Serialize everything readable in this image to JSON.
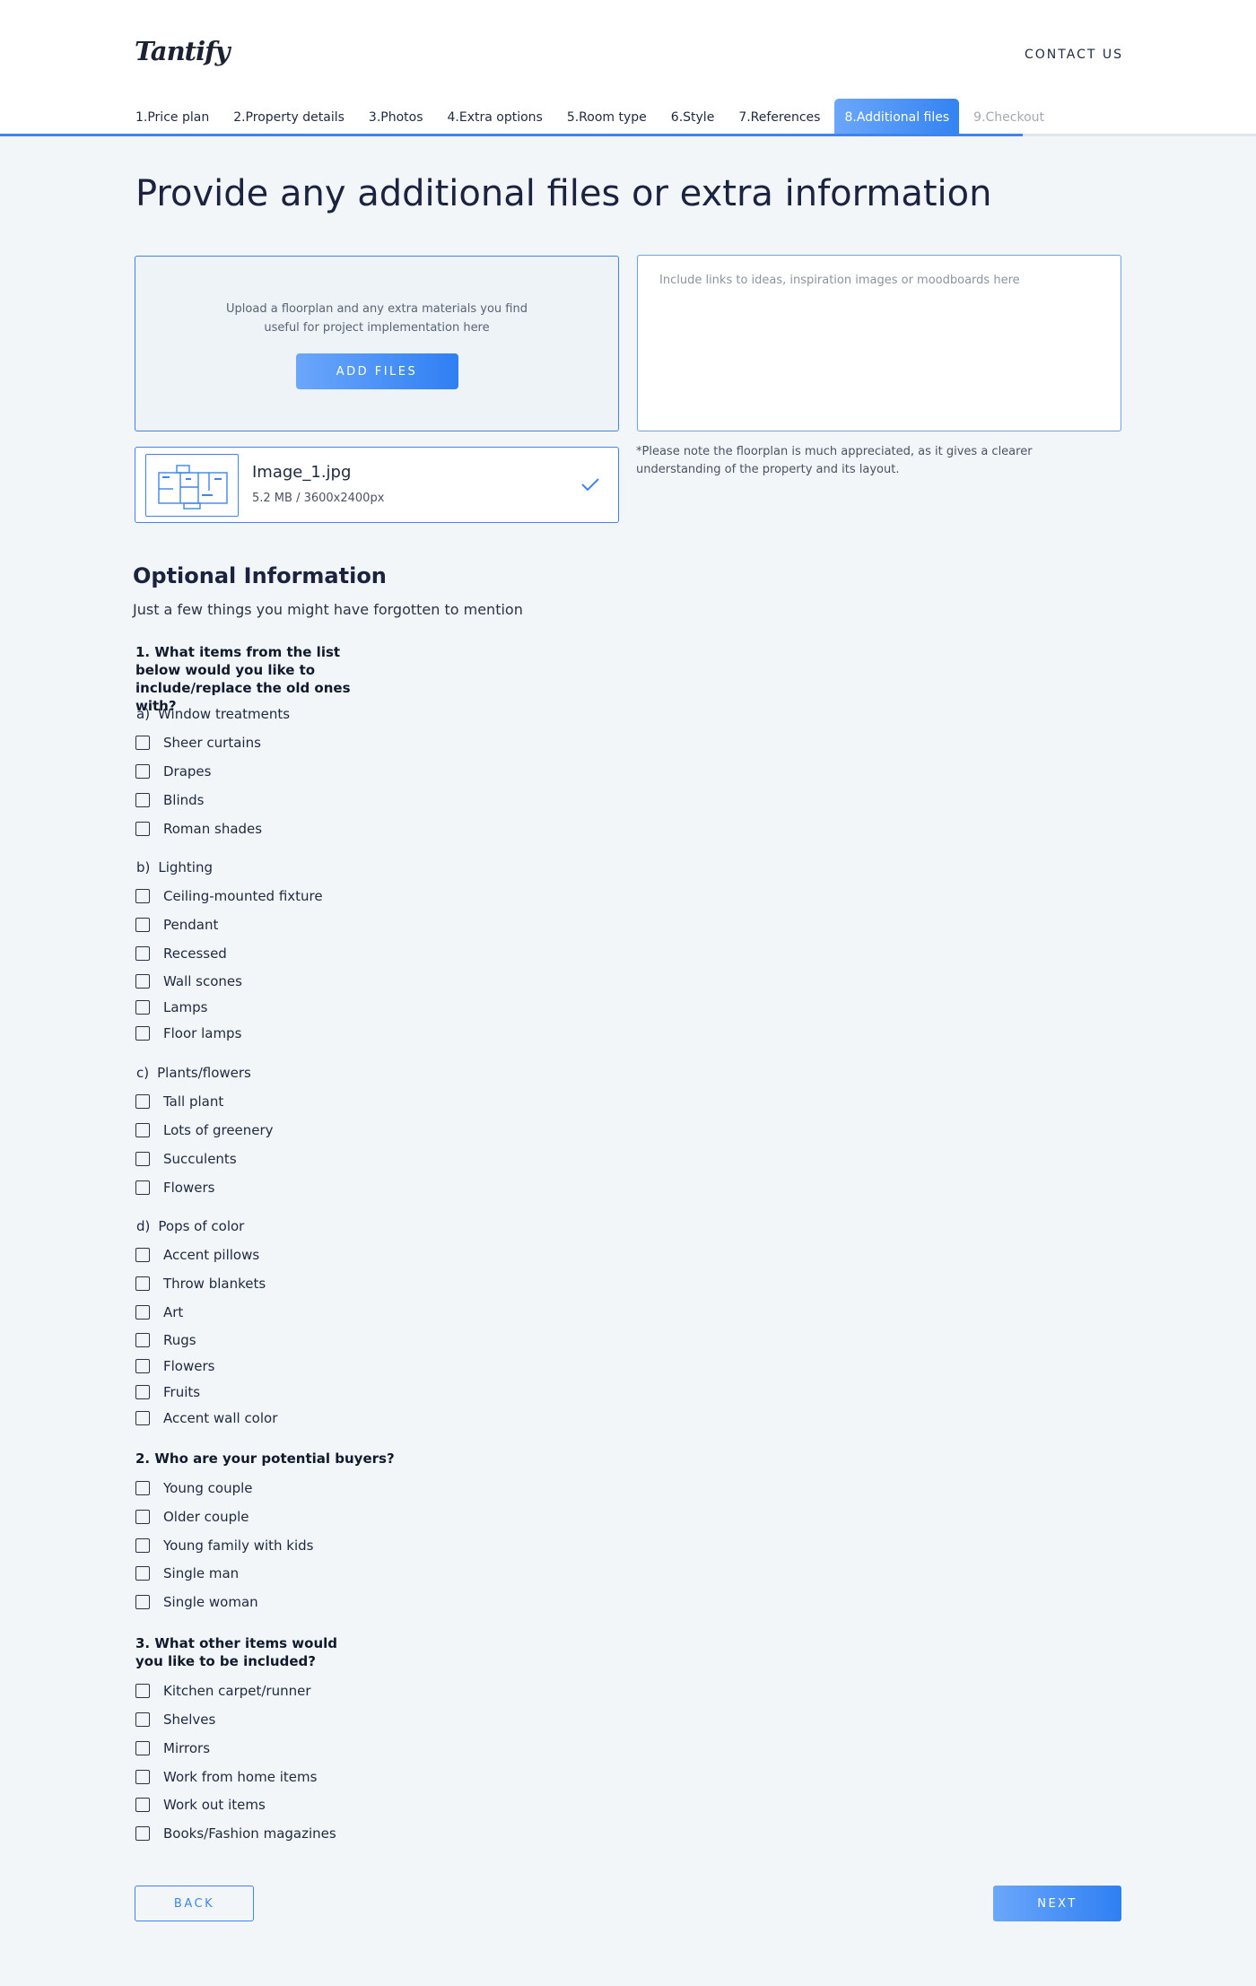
{
  "brand": {
    "logo": "Tantify"
  },
  "header": {
    "contact": "CONTACT US"
  },
  "steps": [
    {
      "label": "1.Price plan",
      "state": "done"
    },
    {
      "label": "2.Property details",
      "state": "done"
    },
    {
      "label": "3.Photos",
      "state": "done"
    },
    {
      "label": "4.Extra options",
      "state": "done"
    },
    {
      "label": "5.Room type",
      "state": "done"
    },
    {
      "label": "6.Style",
      "state": "done"
    },
    {
      "label": "7.References",
      "state": "done"
    },
    {
      "label": "8.Additional files",
      "state": "active"
    },
    {
      "label": "9.Checkout",
      "state": "disabled"
    }
  ],
  "page": {
    "title": "Provide any additional files or extra information"
  },
  "upload": {
    "description": "Upload a floorplan and any extra materials you find useful for project implementation here",
    "button": "ADD FILES"
  },
  "links": {
    "placeholder": "Include links to ideas, inspiration images or moodboards here",
    "value": ""
  },
  "file": {
    "name": "Image_1.jpg",
    "meta": "5.2 MB / 3600x2400px"
  },
  "note": "*Please note the floorplan is much appreciated, as it gives a clearer understanding of the property and its layout.",
  "optional": {
    "title": "Optional Information",
    "subtitle": "Just a few things you might have forgotten to mention"
  },
  "q1": {
    "label": "1. What items from the list below would you like to include/replace the old ones with?",
    "window": {
      "marker": "a)",
      "label": "Window treatments",
      "items": [
        "Sheer curtains",
        "Drapes",
        "Blinds",
        "Roman shades"
      ]
    },
    "lighting": {
      "marker": "b)",
      "label": "Lighting",
      "items": [
        "Ceiling-mounted fixture",
        "Pendant",
        "Recessed",
        "Wall scones",
        "Lamps",
        "Floor lamps"
      ]
    },
    "plants": {
      "marker": "c)",
      "label": "Plants/flowers",
      "items": [
        "Tall plant",
        "Lots of greenery",
        "Succulents",
        "Flowers"
      ]
    },
    "pops": {
      "marker": "d)",
      "label": "Pops of color",
      "items": [
        "Accent pillows",
        "Throw blankets",
        "Art",
        "Rugs",
        "Flowers",
        "Fruits",
        "Accent wall color"
      ]
    }
  },
  "q2": {
    "label": "2. Who are your potential buyers?",
    "items": [
      "Young couple",
      "Older couple",
      "Young family with kids",
      "Single man",
      "Single woman"
    ]
  },
  "q3": {
    "label": "3. What other items would you like to be included?",
    "items": [
      "Kitchen carpet/runner",
      "Shelves",
      "Mirrors",
      "Work from home items",
      "Work out items",
      "Books/Fashion magazines"
    ]
  },
  "nav": {
    "back": "BACK",
    "next": "NEXT"
  },
  "colors": {
    "accent": "#3d84f0",
    "accent_light": "#6ba7fb",
    "background": "#f2f6f9",
    "text": "#1f2940"
  }
}
